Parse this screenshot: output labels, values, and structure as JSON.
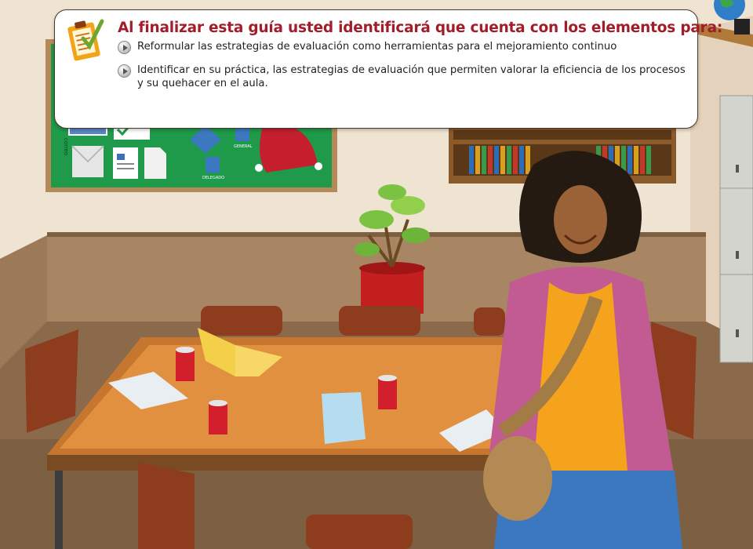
{
  "card": {
    "icon": "clipboard-check-icon",
    "title": "Al finalizar esta guía usted identificará que cuenta con los elementos para:",
    "objectives": [
      "Reformular las estrategias de evaluación como herramientas para el mejoramiento continuo",
      "Identificar en su práctica, las estrategias de evaluación que permiten valorar la eficiencia de los procesos y su quehacer en el aula."
    ]
  },
  "board": {
    "side_label": "correo",
    "label_general": "GENERAL",
    "label_delegado": "DELEGADO"
  },
  "colors": {
    "title": "#a11d2a",
    "board_green": "#1e9a4a",
    "wall": "#efe3d2",
    "floor": "#8a6a4b"
  }
}
